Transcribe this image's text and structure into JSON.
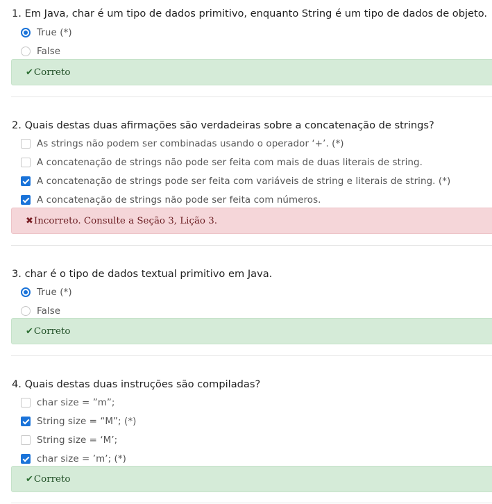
{
  "questions": [
    {
      "title": "1. Em Java, char é um tipo de dados primitivo, enquanto String é um tipo de dados de objeto.",
      "type": "radio",
      "options": [
        {
          "label": "True (*)",
          "selected": true
        },
        {
          "label": "False",
          "selected": false
        }
      ],
      "feedback": {
        "status": "correct",
        "icon": "checkmark-icon",
        "text": "Correto"
      }
    },
    {
      "title": "2. Quais destas duas afirmações são verdadeiras sobre a concatenação de strings?",
      "type": "checkbox",
      "options": [
        {
          "label": "As strings não podem ser combinadas usando o operador ‘+’. (*)",
          "selected": false
        },
        {
          "label": "A concatenação de strings não pode ser feita com mais de duas literais de string.",
          "selected": false
        },
        {
          "label": "A concatenação de strings pode ser feita com variáveis de string e literais de string. (*)",
          "selected": true
        },
        {
          "label": "A concatenação de strings não pode ser feita com números.",
          "selected": true
        }
      ],
      "feedback": {
        "status": "incorrect",
        "icon": "cross-icon",
        "text": "Incorreto. Consulte a Seção 3, Lição 3."
      }
    },
    {
      "title": "3. char é o tipo de dados textual primitivo em Java.",
      "type": "radio",
      "options": [
        {
          "label": "True (*)",
          "selected": true
        },
        {
          "label": "False",
          "selected": false
        }
      ],
      "feedback": {
        "status": "correct",
        "icon": "checkmark-icon",
        "text": "Correto"
      }
    },
    {
      "title": "4. Quais destas duas instruções são compiladas?",
      "type": "checkbox",
      "options": [
        {
          "label": "char size = ”m”;",
          "selected": false
        },
        {
          "label": "String size = “M”; (*)",
          "selected": true
        },
        {
          "label": "String size = ‘M’;",
          "selected": false
        },
        {
          "label": "char size = ’m’; (*)",
          "selected": true
        }
      ],
      "feedback": {
        "status": "correct",
        "icon": "checkmark-icon",
        "text": "Correto"
      }
    }
  ],
  "colors": {
    "accent": "#1a73d9",
    "correct_bg": "#d5ebd8",
    "incorrect_bg": "#f5d6d9"
  }
}
